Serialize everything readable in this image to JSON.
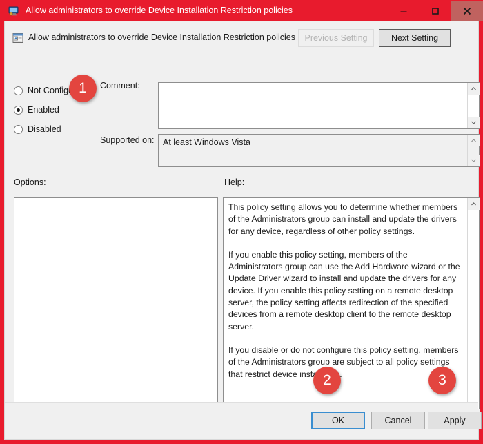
{
  "window": {
    "title": "Allow administrators to override Device Installation Restriction policies",
    "icon": "group-policy-setting-icon",
    "accent_color": "#e81b2d",
    "controls": {
      "minimize_label": "–",
      "maximize_label": "□",
      "close_label": "✕"
    }
  },
  "header": {
    "setting_icon": "policy-setting-icon",
    "setting_title": "Allow administrators to override Device Installation  Restriction policies",
    "previous_setting_label": "Previous Setting",
    "next_setting_label": "Next Setting",
    "previous_setting_enabled": false,
    "next_setting_enabled": true
  },
  "state_options": {
    "selected": "Enabled",
    "items": [
      {
        "id": "not-configured",
        "label": "Not Configured",
        "checked": false
      },
      {
        "id": "enabled",
        "label": "Enabled",
        "checked": true
      },
      {
        "id": "disabled",
        "label": "Disabled",
        "checked": false
      }
    ]
  },
  "comment": {
    "label": "Comment:",
    "value": "",
    "placeholder": ""
  },
  "supported_on": {
    "label": "Supported on:",
    "value": "At least Windows Vista"
  },
  "options": {
    "label": "Options:",
    "content": ""
  },
  "help": {
    "label": "Help:",
    "paragraphs": [
      "This policy setting allows you to determine whether members of the Administrators group can install and update the drivers for any device, regardless of other policy settings.",
      "If you enable this policy setting, members of the Administrators group can use the Add Hardware wizard or the Update Driver wizard to install and update the drivers for any device. If you enable this policy setting on a remote desktop server, the policy setting affects redirection of the specified devices from a remote desktop client to the remote desktop server.",
      "If you disable or do not configure this policy setting, members of the Administrators group are subject to all policy settings that restrict device installation."
    ]
  },
  "footer": {
    "ok_label": "OK",
    "cancel_label": "Cancel",
    "apply_label": "Apply",
    "default_button": "OK"
  },
  "annotations": {
    "badge_color": "#e3453f",
    "items": [
      {
        "number": "1",
        "target": "enabled-radio"
      },
      {
        "number": "2",
        "target": "ok-button"
      },
      {
        "number": "3",
        "target": "apply-button"
      }
    ]
  }
}
